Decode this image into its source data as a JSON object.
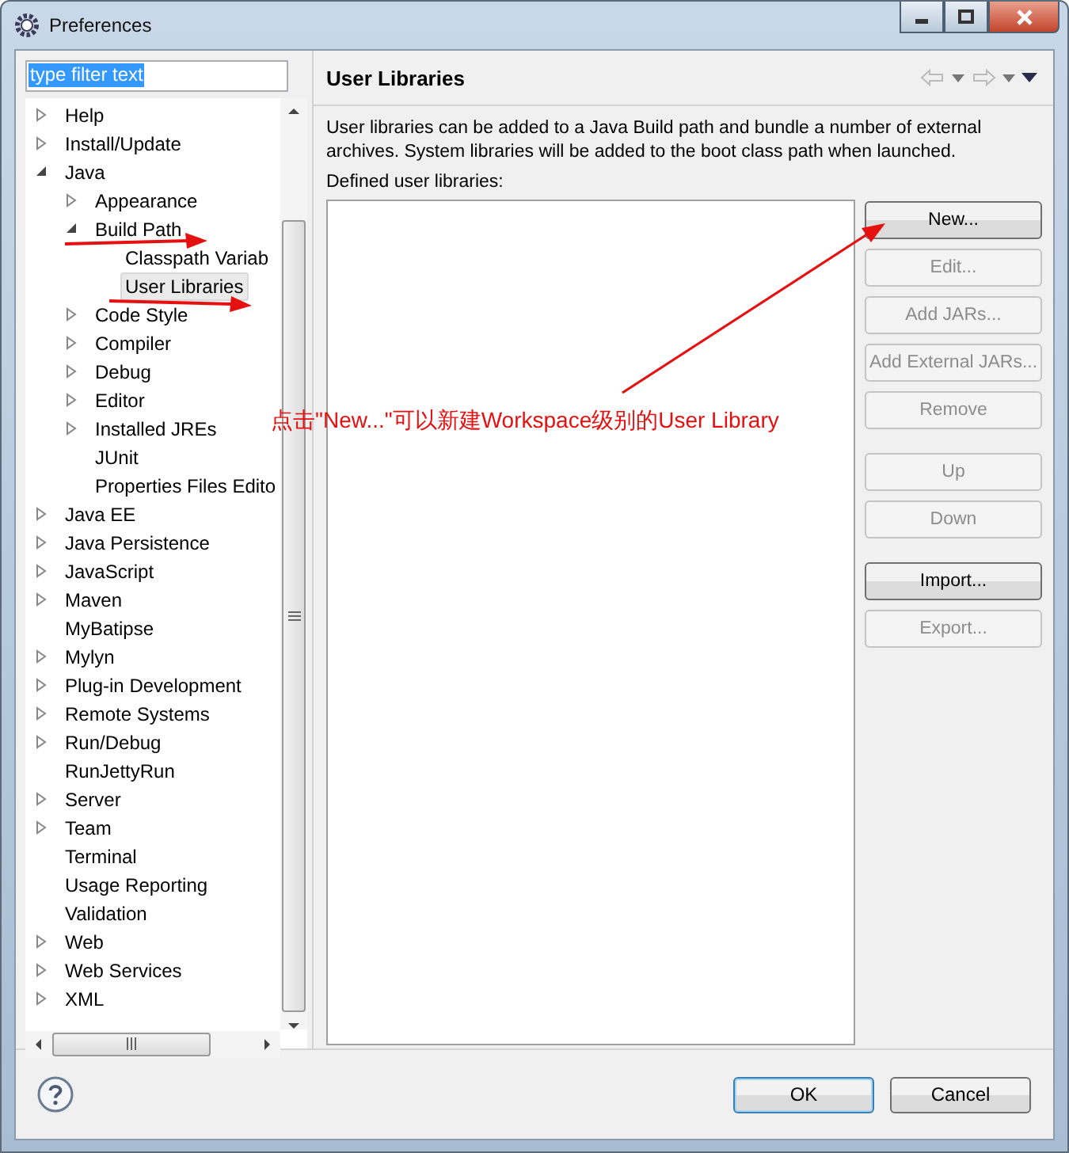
{
  "window": {
    "title": "Preferences"
  },
  "filter": {
    "value": "type filter text",
    "selected": true
  },
  "tree": [
    {
      "label": "Help",
      "expanded": false,
      "selected": false
    },
    {
      "label": "Install/Update",
      "expanded": false,
      "selected": false
    },
    {
      "label": "Java",
      "expanded": true,
      "selected": false,
      "children": [
        {
          "label": "Appearance",
          "expanded": false,
          "selected": false
        },
        {
          "label": "Build Path",
          "expanded": true,
          "selected": false,
          "children": [
            {
              "label": "Classpath Variab",
              "selected": false
            },
            {
              "label": "User Libraries",
              "selected": true
            }
          ]
        },
        {
          "label": "Code Style",
          "expanded": false,
          "selected": false
        },
        {
          "label": "Compiler",
          "expanded": false,
          "selected": false
        },
        {
          "label": "Debug",
          "expanded": false,
          "selected": false
        },
        {
          "label": "Editor",
          "expanded": false,
          "selected": false
        },
        {
          "label": "Installed JREs",
          "expanded": false,
          "selected": false
        },
        {
          "label": "JUnit",
          "selected": false
        },
        {
          "label": "Properties Files Edito",
          "selected": false
        }
      ]
    },
    {
      "label": "Java EE",
      "expanded": false,
      "selected": false
    },
    {
      "label": "Java Persistence",
      "expanded": false,
      "selected": false
    },
    {
      "label": "JavaScript",
      "expanded": false,
      "selected": false
    },
    {
      "label": "Maven",
      "expanded": false,
      "selected": false
    },
    {
      "label": "MyBatipse",
      "selected": false
    },
    {
      "label": "Mylyn",
      "expanded": false,
      "selected": false
    },
    {
      "label": "Plug-in Development",
      "expanded": false,
      "selected": false
    },
    {
      "label": "Remote Systems",
      "expanded": false,
      "selected": false
    },
    {
      "label": "Run/Debug",
      "expanded": false,
      "selected": false
    },
    {
      "label": "RunJettyRun",
      "selected": false
    },
    {
      "label": "Server",
      "expanded": false,
      "selected": false
    },
    {
      "label": "Team",
      "expanded": false,
      "selected": false
    },
    {
      "label": "Terminal",
      "selected": false
    },
    {
      "label": "Usage Reporting",
      "selected": false
    },
    {
      "label": "Validation",
      "selected": false
    },
    {
      "label": "Web",
      "expanded": false,
      "selected": false
    },
    {
      "label": "Web Services",
      "expanded": false,
      "selected": false
    },
    {
      "label": "XML",
      "expanded": false,
      "selected": false
    }
  ],
  "page": {
    "title": "User Libraries",
    "description": "User libraries can be added to a Java Build path and bundle a number of external archives. System libraries will be added to the boot class path when launched.",
    "list_label": "Defined user libraries:",
    "button_groups": [
      [
        {
          "label": "New...",
          "disabled": false
        },
        {
          "label": "Edit...",
          "disabled": true
        },
        {
          "label": "Add JARs...",
          "disabled": true
        },
        {
          "label": "Add External JARs...",
          "disabled": true
        },
        {
          "label": "Remove",
          "disabled": true
        }
      ],
      [
        {
          "label": "Up",
          "disabled": true
        },
        {
          "label": "Down",
          "disabled": true
        }
      ],
      [
        {
          "label": "Import...",
          "disabled": false
        },
        {
          "label": "Export...",
          "disabled": true
        }
      ]
    ]
  },
  "annotation": "点击\"New...\"可以新建Workspace级别的User Library",
  "footer_buttons": [
    {
      "label": "OK",
      "default": true
    },
    {
      "label": "Cancel",
      "default": false
    }
  ]
}
